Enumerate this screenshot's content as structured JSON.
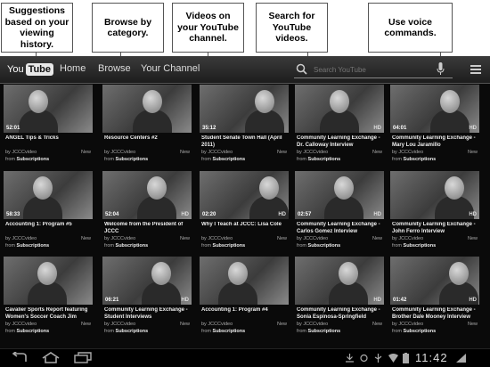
{
  "callouts": [
    {
      "text": "Suggestions based on your viewing history."
    },
    {
      "text": "Browse by category."
    },
    {
      "text": "Videos on your YouTube channel."
    },
    {
      "text": "Search for YouTube videos."
    },
    {
      "text": "Use voice commands."
    }
  ],
  "app": {
    "logo_you": "You",
    "logo_tube": "Tube",
    "nav": [
      "Home",
      "Browse",
      "Your Channel"
    ],
    "search_placeholder": "Search YouTube"
  },
  "videos": [
    {
      "duration": "52:01",
      "hd": "",
      "title": "ANGEL Tips & Tricks",
      "by": "by JCCCvideo",
      "from": "Subscriptions",
      "new": "New"
    },
    {
      "duration": "",
      "hd": "",
      "title": "Resource Centers #2",
      "by": "by JCCCvideo",
      "from": "Subscriptions",
      "new": "New"
    },
    {
      "duration": "35:12",
      "hd": "",
      "title": "Student Senate Town Hall (April 2011)",
      "by": "by JCCCvideo",
      "from": "Subscriptions",
      "new": "New"
    },
    {
      "duration": "",
      "hd": "HD",
      "title": "Community Learning Exchange - Dr. Calloway Interview",
      "by": "by JCCCvideo",
      "from": "Subscriptions",
      "new": "New"
    },
    {
      "duration": "04:01",
      "hd": "HD",
      "title": "Community Learning Exchange - Mary Lou Jaramillo",
      "by": "by JCCCvideo",
      "from": "Subscriptions",
      "new": "New"
    },
    {
      "duration": "58:33",
      "hd": "",
      "title": "Accounting 1: Program #5",
      "by": "by JCCCvideo",
      "from": "Subscriptions",
      "new": "New"
    },
    {
      "duration": "52:04",
      "hd": "HD",
      "title": "Welcome from the President of JCCC",
      "by": "by JCCCvideo",
      "from": "Subscriptions",
      "new": "New"
    },
    {
      "duration": "02:20",
      "hd": "HD",
      "title": "Why I Teach at JCCC: Lisa Cole",
      "by": "by JCCCvideo",
      "from": "Subscriptions",
      "new": "New"
    },
    {
      "duration": "02:57",
      "hd": "HD",
      "title": "Community Learning Exchange - Carlos Gomez Interview",
      "by": "by JCCCvideo",
      "from": "Subscriptions",
      "new": "New"
    },
    {
      "duration": "",
      "hd": "HD",
      "title": "Community Learning Exchange - John Ferro Interview",
      "by": "by JCCCvideo",
      "from": "Subscriptions",
      "new": "New"
    },
    {
      "duration": "",
      "hd": "",
      "title": "Cavalier Sports Report featuring Women's Soccer Coach Jim Schwab",
      "by": "by JCCCvideo",
      "from": "Subscriptions",
      "new": "New"
    },
    {
      "duration": "06:21",
      "hd": "HD",
      "title": "Community Learning Exchange - Student Interviews",
      "by": "by JCCCvideo",
      "from": "Subscriptions",
      "new": "New"
    },
    {
      "duration": "",
      "hd": "",
      "title": "Accounting 1: Program #4",
      "by": "by JCCCvideo",
      "from": "Subscriptions",
      "new": "New"
    },
    {
      "duration": "",
      "hd": "HD",
      "title": "Community Learning Exchange - Sonia Espinosa-Springfield Interview",
      "by": "by JCCCvideo",
      "from": "Subscriptions",
      "new": "New"
    },
    {
      "duration": "01:42",
      "hd": "HD",
      "title": "Community Learning Exchange - Brother Dale Mooney Interview",
      "by": "by JCCCvideo",
      "from": "Subscriptions",
      "new": "New"
    }
  ],
  "status": {
    "clock": "11:42"
  }
}
